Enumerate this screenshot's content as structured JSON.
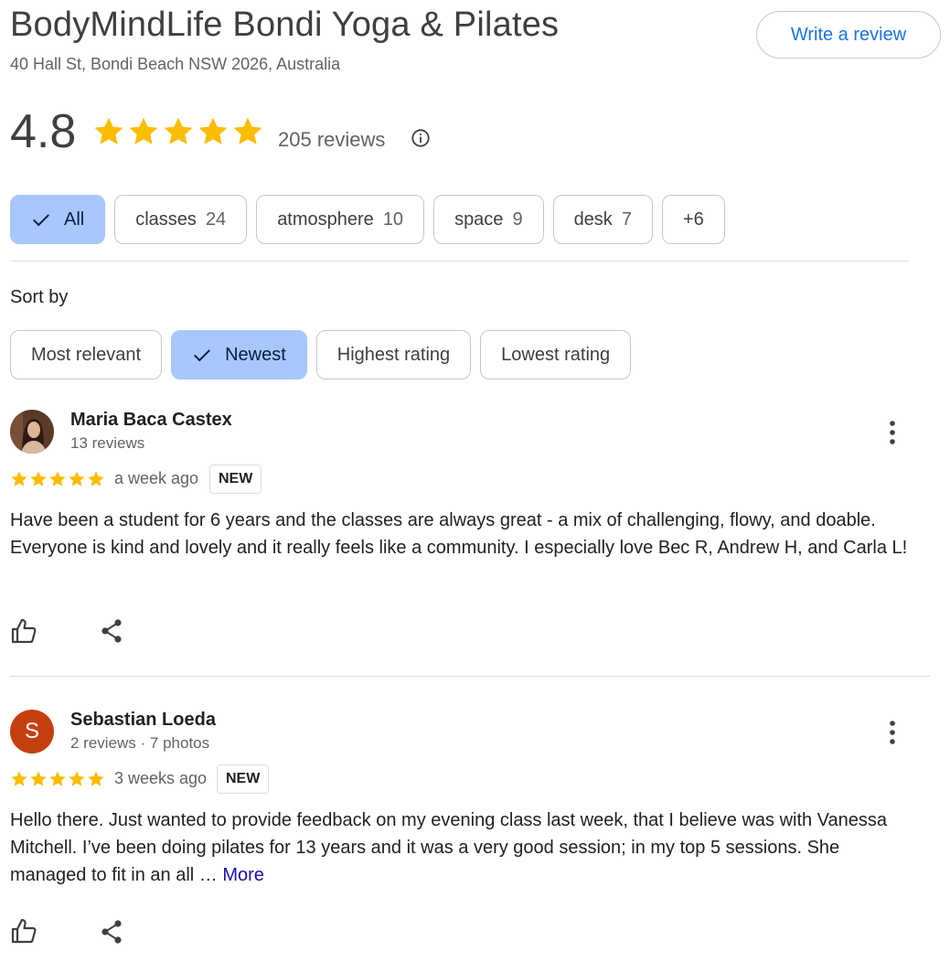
{
  "header": {
    "title": "BodyMindLife Bondi Yoga & Pilates",
    "address": "40 Hall St, Bondi Beach NSW 2026, Australia",
    "write_review_label": "Write a review"
  },
  "summary": {
    "rating": "4.8",
    "stars": 5,
    "reviews_count": "205 reviews"
  },
  "topics": [
    {
      "label": "All",
      "count": "",
      "selected": true
    },
    {
      "label": "classes",
      "count": "24"
    },
    {
      "label": "atmosphere",
      "count": "10"
    },
    {
      "label": "space",
      "count": "9"
    },
    {
      "label": "desk",
      "count": "7"
    },
    {
      "label": "+6",
      "count": ""
    }
  ],
  "sort": {
    "label": "Sort by",
    "options": [
      "Most relevant",
      "Newest",
      "Highest rating",
      "Lowest rating"
    ],
    "selected": "Newest"
  },
  "reviews": [
    {
      "name": "Maria Baca Castex",
      "meta": "13 reviews",
      "avatar": "photo",
      "stars": 5,
      "date": "a week ago",
      "badge": "NEW",
      "text": "Have been a student for 6 years and the classes are always great - a mix of challenging, flowy, and doable. Everyone is kind and lovely and it really feels like a community. I especially love Bec R, Andrew H, and Carla L!",
      "more": ""
    },
    {
      "name": "Sebastian Loeda",
      "meta": "2 reviews · 7 photos",
      "avatar_letter": "S",
      "stars": 5,
      "date": "3 weeks ago",
      "badge": "NEW",
      "text": "Hello there. Just wanted to provide feedback on my evening class last week, that I believe was with Vanessa Mitchell. I’ve been doing pilates for 13 years and it was a very good session; in my top 5 sessions. She managed to fit in an all … ",
      "more": "More"
    }
  ],
  "colors": {
    "star": "#fbbc04",
    "chip_selected": "#a8c7fa",
    "link_blue": "#1a73e8",
    "avatar_letter_bg": "#c5400f"
  }
}
